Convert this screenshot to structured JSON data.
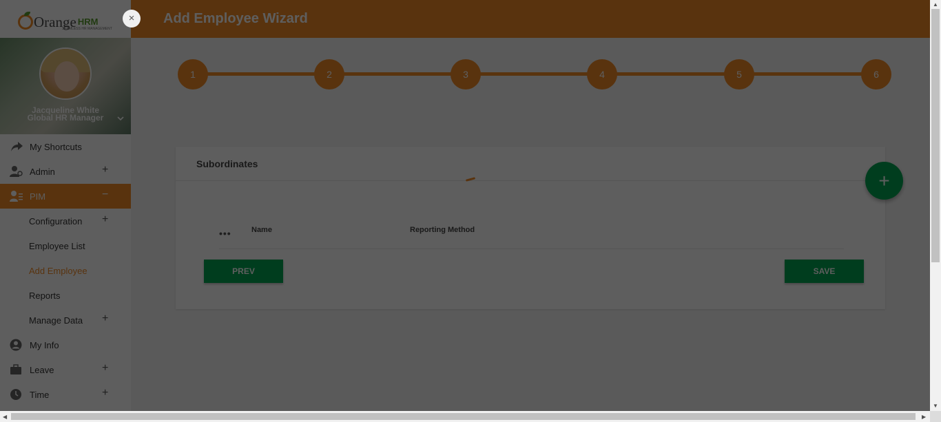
{
  "app": {
    "logo_main": "Orange",
    "logo_brand": "HRM",
    "logo_tagline": "SEAMLESS HR MANAGEMENT"
  },
  "header": {
    "title": "Add Employee Wizard",
    "close_label": "×"
  },
  "profile": {
    "name": "Jacqueline White",
    "role": "Global HR Manager"
  },
  "sidebar": {
    "items": [
      {
        "label": "My Shortcuts",
        "icon": "share-arrow-icon"
      },
      {
        "label": "Admin",
        "icon": "admin-user-icon",
        "expand": "+"
      },
      {
        "label": "PIM",
        "icon": "pim-user-icon",
        "expand": "−"
      },
      {
        "label": "Configuration",
        "expand": "+"
      },
      {
        "label": "Employee List"
      },
      {
        "label": "Add Employee"
      },
      {
        "label": "Reports"
      },
      {
        "label": "Manage Data",
        "expand": "+"
      },
      {
        "label": "My Info",
        "icon": "account-circle-icon"
      },
      {
        "label": "Leave",
        "icon": "briefcase-icon",
        "expand": "+"
      },
      {
        "label": "Time",
        "icon": "clock-icon",
        "expand": "+"
      }
    ]
  },
  "wizard": {
    "steps": [
      "1",
      "2",
      "3",
      "4",
      "5",
      "6"
    ]
  },
  "card": {
    "title": "Subordinates",
    "dots": "•••",
    "columns": [
      "Name",
      "Reporting Method"
    ],
    "prev_label": "PREV",
    "save_label": "SAVE",
    "fab_label": "+"
  },
  "colors": {
    "accent": "#f28c28",
    "green": "#00a651",
    "overlay": "rgba(0,0,0,0.63)"
  }
}
